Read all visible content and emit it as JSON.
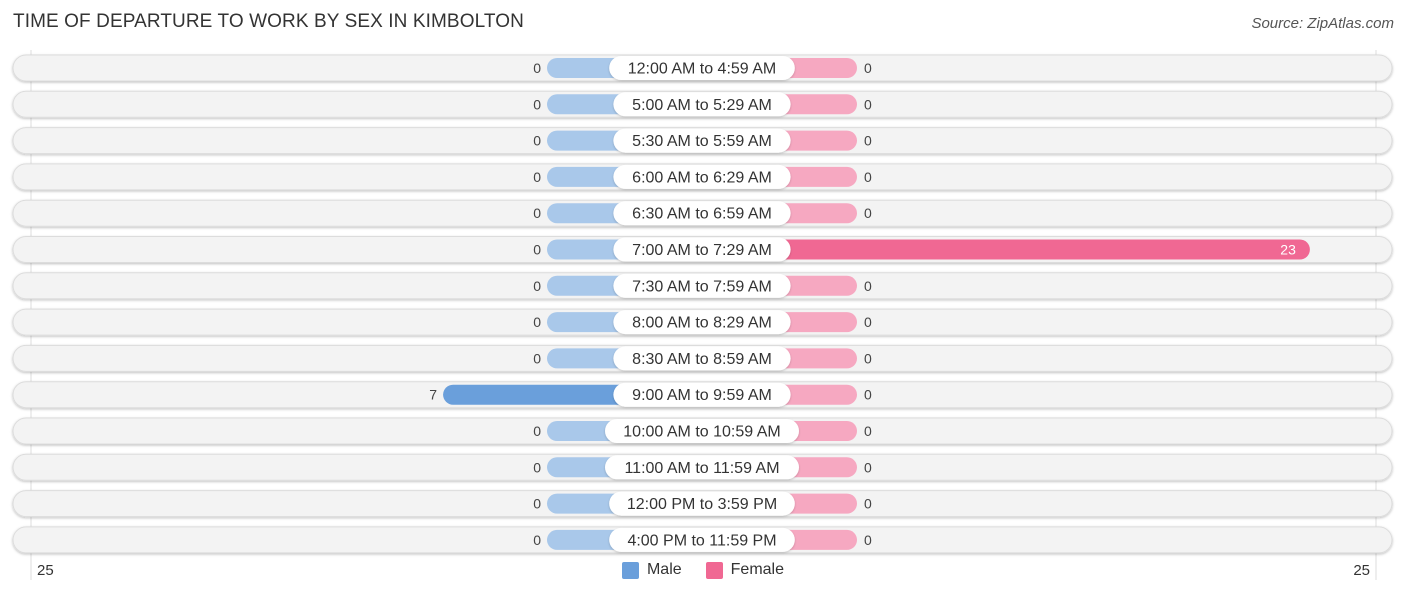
{
  "chart_data": {
    "type": "bar",
    "orientation": "horizontal-diverging",
    "title": "TIME OF DEPARTURE TO WORK BY SEX IN KIMBOLTON",
    "source": "Source: ZipAtlas.com",
    "categories": [
      "12:00 AM to 4:59 AM",
      "5:00 AM to 5:29 AM",
      "5:30 AM to 5:59 AM",
      "6:00 AM to 6:29 AM",
      "6:30 AM to 6:59 AM",
      "7:00 AM to 7:29 AM",
      "7:30 AM to 7:59 AM",
      "8:00 AM to 8:29 AM",
      "8:30 AM to 8:59 AM",
      "9:00 AM to 9:59 AM",
      "10:00 AM to 10:59 AM",
      "11:00 AM to 11:59 AM",
      "12:00 PM to 3:59 PM",
      "4:00 PM to 11:59 PM"
    ],
    "series": [
      {
        "name": "Male",
        "color": "#6a9fdb",
        "light_color": "#a9c8ea",
        "values": [
          0,
          0,
          0,
          0,
          0,
          0,
          0,
          0,
          0,
          7,
          0,
          0,
          0,
          0
        ]
      },
      {
        "name": "Female",
        "color": "#f06893",
        "light_color": "#f6a8c1",
        "values": [
          0,
          0,
          0,
          0,
          0,
          23,
          0,
          0,
          0,
          0,
          0,
          0,
          0,
          0
        ]
      }
    ],
    "xlim": [
      -25,
      25
    ],
    "axis_tick_labels": {
      "left": "25",
      "right": "25"
    },
    "legend": {
      "position": "bottom-center",
      "entries": [
        "Male",
        "Female"
      ]
    },
    "grid": false
  }
}
